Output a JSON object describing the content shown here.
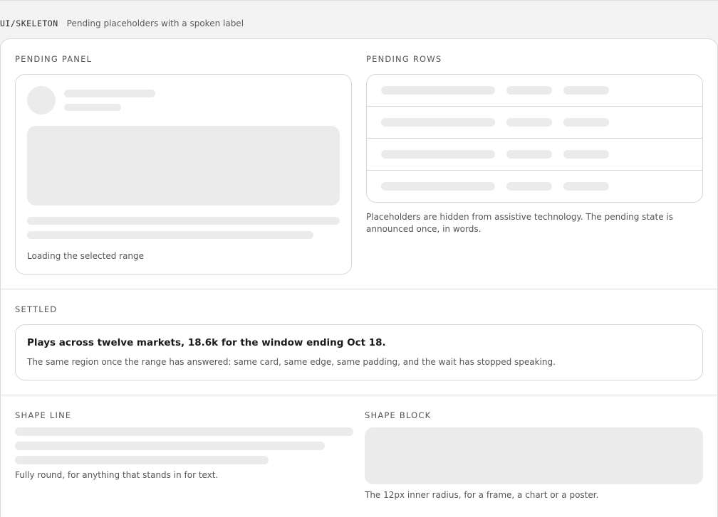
{
  "header": {
    "tag": "UI/SKELETON",
    "description": "Pending placeholders with a spoken label"
  },
  "pending_panel": {
    "label": "PENDING PANEL",
    "status_text": "Loading the selected range"
  },
  "pending_rows": {
    "label": "PENDING ROWS",
    "row_count": 4,
    "note": "Placeholders are hidden from assistive technology. The pending state is announced once, in words."
  },
  "settled": {
    "label": "SETTLED",
    "title": "Plays across twelve markets, 18.6k for the window ending Oct 18.",
    "body": "The same region once the range has answered: same card, same edge, same padding, and the wait has stopped speaking."
  },
  "shape_line": {
    "label": "SHAPE LINE",
    "caption": "Fully round, for anything that stands in for text."
  },
  "shape_block": {
    "label": "SHAPE BLOCK",
    "caption": "The 12px inner radius, for a frame, a chart or a poster."
  },
  "colors": {
    "placeholder": "#ebebeb",
    "border": "#d6d6d6",
    "background": "#f3f3f3",
    "surface": "#ffffff"
  }
}
